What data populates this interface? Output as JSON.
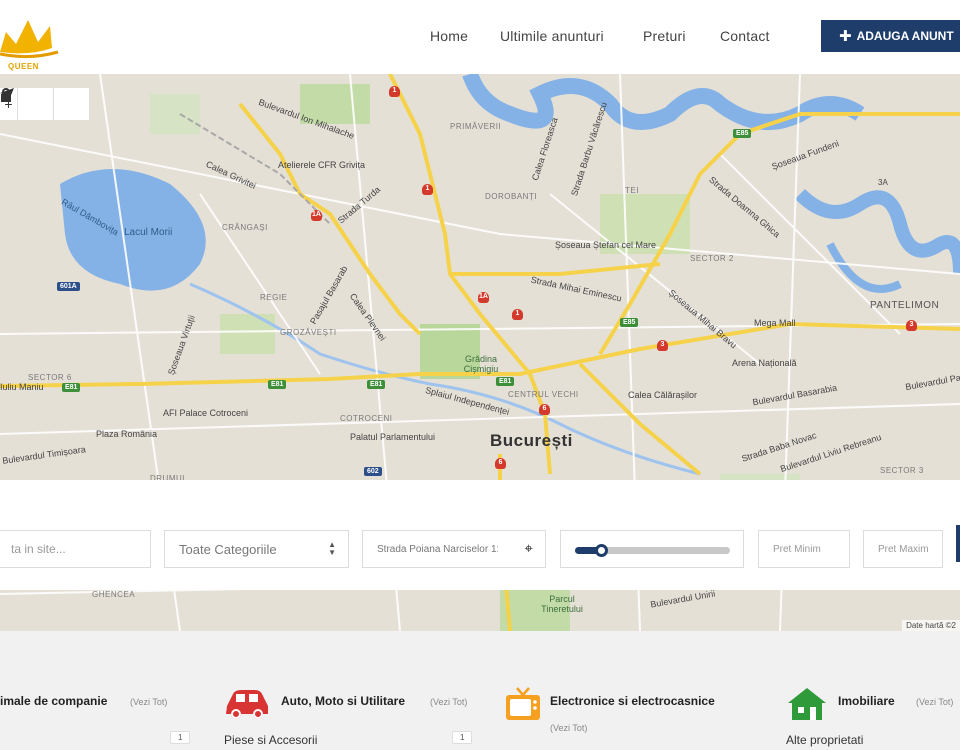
{
  "header": {
    "logo_text": "QUEEN",
    "nav": [
      "Home",
      "Ultimile anunturi",
      "Preturi",
      "Contact"
    ],
    "add_button": "ADAUGA ANUNT"
  },
  "map": {
    "city": "București",
    "places": [
      "Atelierele CFR Grivița",
      "Lacul Morii",
      "Râul Dâmbovița",
      "Mega Mall",
      "Arena Națională",
      "AFI Palace Cotroceni",
      "Plaza România",
      "Palatul Parlamentului",
      "Grădina Cișmigiu",
      "Parcul Tineretului"
    ],
    "streets": [
      "Bulevardul Ion Mihalache",
      "Calea Grivitei",
      "Strada Turda",
      "Șoseaua Ștefan cel Mare",
      "Strada Mihai Eminescu",
      "Șoseaua Mihai Bravu",
      "Splaiul Independenței",
      "Calea Călărașilor",
      "Bulevardul Basarabia",
      "Strada Baba Novac",
      "Bulevardul Timișoara",
      "Șoseaua Virtuții",
      "Calea Plevnei",
      "Pasajul Basarab",
      "Calea Floreasca",
      "Strada Barbu Văcărescu",
      "Șoseaua Fundeni",
      "Strada Doamna Ghica",
      "Bulevardul Pache",
      "Bulevardul Liviu Rebreanu",
      "Strada Poiana Narciselor",
      "Bulevardul Unirii",
      "Iuliu Maniu"
    ],
    "districts": [
      "PRIMĂVERII",
      "DOROBANȚI",
      "TEI",
      "CRÂNGAȘI",
      "REGIE",
      "GROZĂVEȘTI",
      "SECTOR 6",
      "SECTOR 2",
      "SECTOR 3",
      "PANTELIMON",
      "COTROCENI",
      "CENTRUL VECHI",
      "DRUMUL",
      "GHENCEA"
    ],
    "road_badges": [
      "E85",
      "E81",
      "601A",
      "602",
      "1A",
      "1",
      "3",
      "6",
      "3A"
    ],
    "credit": "Date hartă ©2",
    "tools": [
      "+",
      "lock",
      "send"
    ]
  },
  "search": {
    "keyword_placeholder": "ta in site...",
    "category_value": "Toate Categoriile",
    "location_value": "Strada Poiana Narciselor 1:",
    "price_min_placeholder": "Pret Minim",
    "price_max_placeholder": "Pret Maxim",
    "slider_value_fraction": 0.17
  },
  "categories": [
    {
      "title": "imale de companie",
      "view_all": "(Vezi Tot)",
      "count": "1",
      "sub": ""
    },
    {
      "title": "Auto, Moto si Utilitare",
      "view_all": "(Vezi Tot)",
      "count": "1",
      "sub": "Piese si Accesorii"
    },
    {
      "title": "Electronice si electrocasnice",
      "view_all": "(Vezi Tot)",
      "count": "",
      "sub": ""
    },
    {
      "title": "Imobiliare",
      "view_all": "(Vezi Tot)",
      "count": "",
      "sub": "Alte proprietati"
    }
  ],
  "colors": {
    "brand": "#1e3d6b",
    "car_icon": "#d93434",
    "tv_icon": "#f5a020",
    "house_icon": "#2f9a3a",
    "map_road": "#f5d24a",
    "map_water": "#85b2e6",
    "map_park": "#c3dba7"
  }
}
